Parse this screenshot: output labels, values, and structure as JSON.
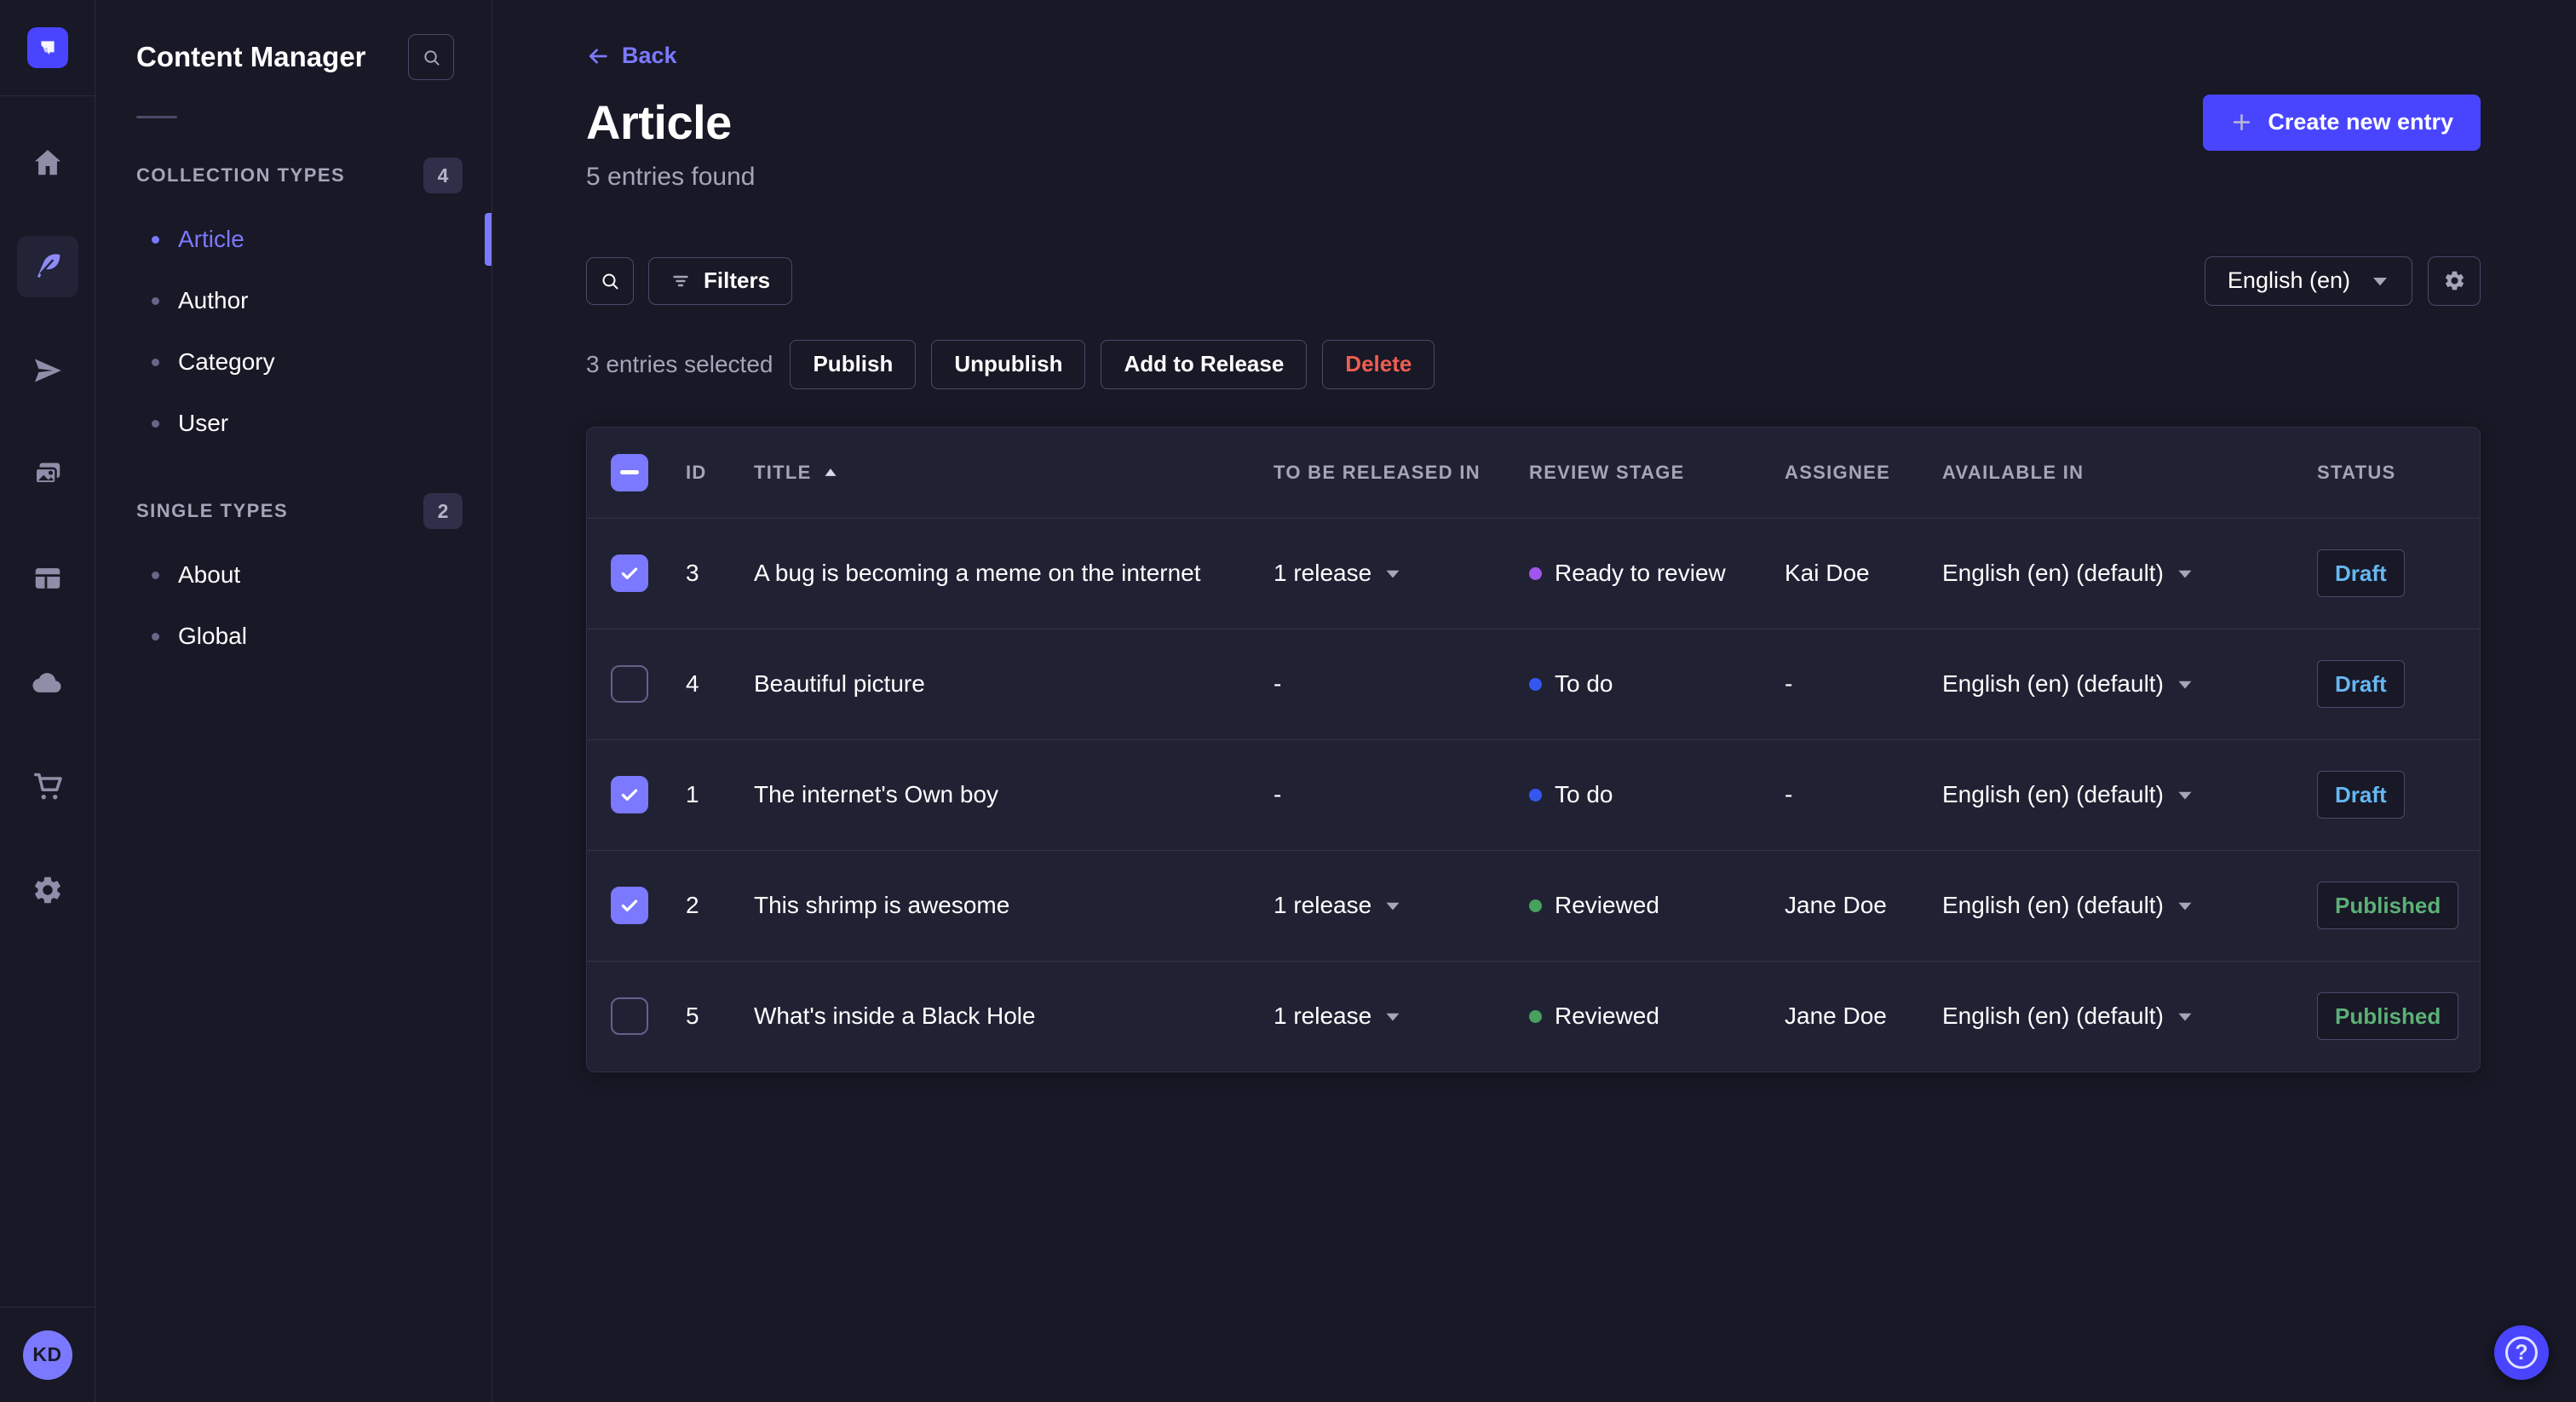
{
  "app": {
    "title": "Content Manager"
  },
  "rail": {
    "items": [
      {
        "icon": "home-icon",
        "active": false
      },
      {
        "icon": "content-manager-icon",
        "active": true
      },
      {
        "icon": "releases-icon",
        "active": false
      },
      {
        "icon": "media-library-icon",
        "active": false
      },
      {
        "icon": "content-type-builder-icon",
        "active": false
      },
      {
        "icon": "deploy-icon",
        "active": false
      },
      {
        "icon": "marketplace-icon",
        "active": false
      },
      {
        "icon": "settings-icon",
        "active": false
      }
    ],
    "avatar_initials": "KD"
  },
  "sidebar": {
    "title": "Content Manager",
    "sections": [
      {
        "label": "COLLECTION TYPES",
        "count": "4",
        "items": [
          {
            "label": "Article",
            "active": true
          },
          {
            "label": "Author",
            "active": false
          },
          {
            "label": "Category",
            "active": false
          },
          {
            "label": "User",
            "active": false
          }
        ]
      },
      {
        "label": "SINGLE TYPES",
        "count": "2",
        "items": [
          {
            "label": "About",
            "active": false
          },
          {
            "label": "Global",
            "active": false
          }
        ]
      }
    ]
  },
  "header": {
    "back_label": "Back",
    "title": "Article",
    "subtitle": "5 entries found",
    "create_label": "Create new entry"
  },
  "toolbar": {
    "filters_label": "Filters",
    "locale_value": "English (en)"
  },
  "selection": {
    "text": "3 entries selected",
    "publish_label": "Publish",
    "unpublish_label": "Unpublish",
    "add_to_release_label": "Add to Release",
    "delete_label": "Delete"
  },
  "table": {
    "header_checkbox_state": "indeterminate",
    "sorted_column": "TITLE",
    "sort_direction": "asc",
    "columns": {
      "id": "ID",
      "title": "TITLE",
      "released": "TO BE RELEASED IN",
      "review": "REVIEW STAGE",
      "assignee": "ASSIGNEE",
      "available": "AVAILABLE IN",
      "status": "STATUS"
    },
    "rows": [
      {
        "checked": true,
        "id": "3",
        "title": "A bug is becoming a meme on the internet",
        "release": "1 release",
        "review_stage": "Ready to review",
        "review_color": "#a155ec",
        "assignee": "Kai Doe",
        "available_in": "English (en) (default)",
        "status": "Draft"
      },
      {
        "checked": false,
        "id": "4",
        "title": "Beautiful picture",
        "release": "-",
        "review_stage": "To do",
        "review_color": "#3557f0",
        "assignee": "-",
        "available_in": "English (en) (default)",
        "status": "Draft"
      },
      {
        "checked": true,
        "id": "1",
        "title": "The internet's Own boy",
        "release": "-",
        "review_stage": "To do",
        "review_color": "#3557f0",
        "assignee": "-",
        "available_in": "English (en) (default)",
        "status": "Draft"
      },
      {
        "checked": true,
        "id": "2",
        "title": "This shrimp is awesome",
        "release": "1 release",
        "review_stage": "Reviewed",
        "review_color": "#46a25c",
        "assignee": "Jane Doe",
        "available_in": "English (en) (default)",
        "status": "Published"
      },
      {
        "checked": false,
        "id": "5",
        "title": "What's inside a Black Hole",
        "release": "1 release",
        "review_stage": "Reviewed",
        "review_color": "#46a25c",
        "assignee": "Jane Doe",
        "available_in": "English (en) (default)",
        "status": "Published"
      }
    ]
  },
  "colors": {
    "accent": "#4945ff",
    "link": "#7b79ff",
    "danger": "#ee5e52",
    "draft": "#66b7f1",
    "published": "#5cb176",
    "panel": "#212134",
    "background": "#181826"
  }
}
